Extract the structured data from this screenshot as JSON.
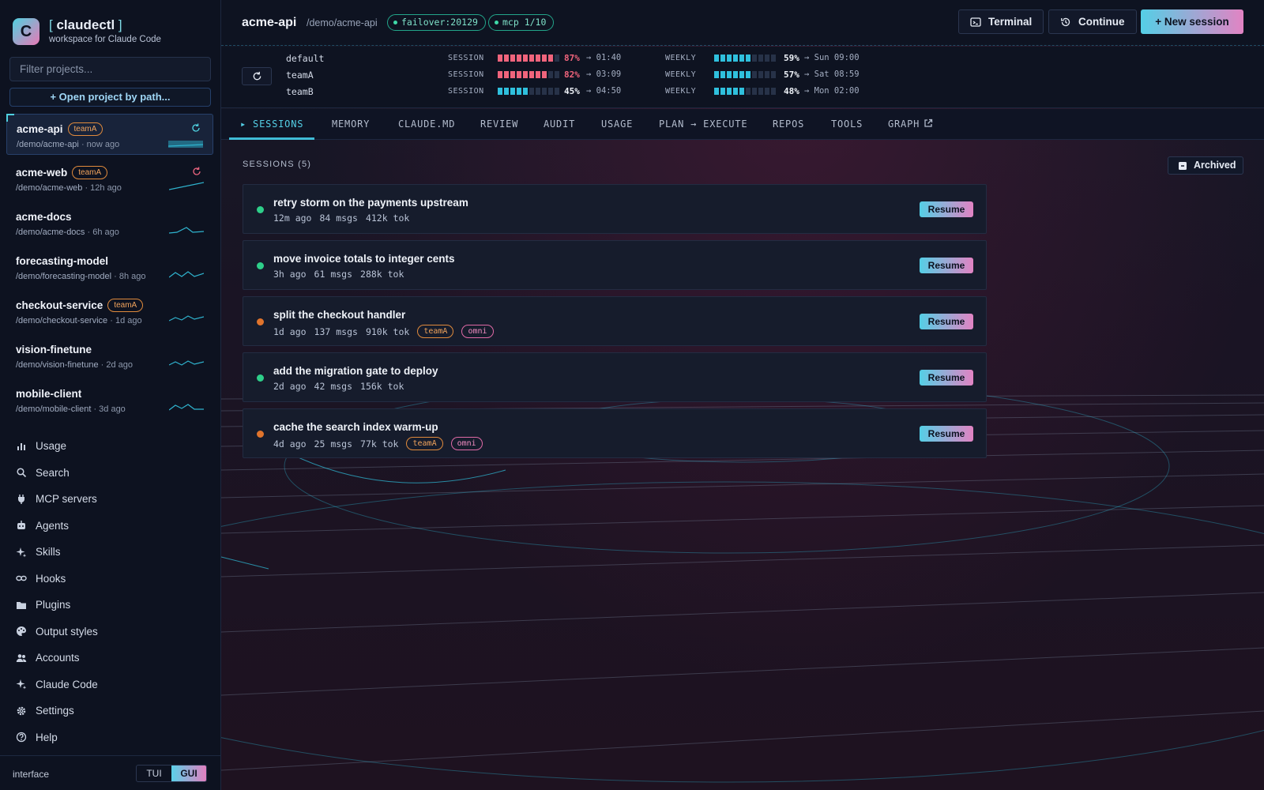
{
  "brand": {
    "logo_letter": "C",
    "bracket_open": "[",
    "name": "claudectl",
    "bracket_close": "]",
    "subtitle": "workspace for Claude Code"
  },
  "sidebar": {
    "filter_placeholder": "Filter projects...",
    "open_project_label": "+ Open project by path...",
    "projects": [
      {
        "name": "acme-api",
        "tag": "teamA",
        "path": "/demo/acme-api",
        "age": "· now ago",
        "active": true
      },
      {
        "name": "acme-web",
        "tag": "teamA",
        "path": "/demo/acme-web",
        "age": "· 12h ago"
      },
      {
        "name": "acme-docs",
        "tag": "",
        "path": "/demo/acme-docs",
        "age": "· 6h ago"
      },
      {
        "name": "forecasting-model",
        "tag": "",
        "path": "/demo/forecasting-model",
        "age": "· 8h ago"
      },
      {
        "name": "checkout-service",
        "tag": "teamA",
        "path": "/demo/checkout-service",
        "age": "· 1d ago"
      },
      {
        "name": "vision-finetune",
        "tag": "",
        "path": "/demo/vision-finetune",
        "age": "· 2d ago"
      },
      {
        "name": "mobile-client",
        "tag": "",
        "path": "/demo/mobile-client",
        "age": "· 3d ago"
      }
    ],
    "nav": [
      {
        "label": "Usage",
        "icon": "bar-chart-icon"
      },
      {
        "label": "Search",
        "icon": "search-icon"
      },
      {
        "label": "MCP servers",
        "icon": "plug-icon"
      },
      {
        "label": "Agents",
        "icon": "robot-icon"
      },
      {
        "label": "Skills",
        "icon": "sparkle-icon"
      },
      {
        "label": "Hooks",
        "icon": "link-icon"
      },
      {
        "label": "Plugins",
        "icon": "folder-icon"
      },
      {
        "label": "Output styles",
        "icon": "palette-icon"
      },
      {
        "label": "Accounts",
        "icon": "users-icon"
      },
      {
        "label": "Claude Code",
        "icon": "sparkle-icon"
      },
      {
        "label": "Settings",
        "icon": "gear-icon"
      },
      {
        "label": "Help",
        "icon": "help-icon"
      }
    ],
    "interface_label": "interface",
    "interface_options": [
      "TUI",
      "GUI"
    ],
    "interface_selected": "GUI"
  },
  "header": {
    "title": "acme-api",
    "path": "/demo/acme-api",
    "badges": [
      "failover:20129",
      "mcp 1/10"
    ],
    "terminal_label": "Terminal",
    "continue_label": "Continue",
    "new_session_label": "+  New session"
  },
  "usage": {
    "session_label": "SESSION",
    "weekly_label": "WEEKLY",
    "rows": [
      {
        "account": "default",
        "session_pct": "87%",
        "session_reset": "→ 01:40",
        "session_level": 0.87,
        "weekly_pct": "59%",
        "weekly_reset": "→ Sun 09:00",
        "weekly_level": 0.59
      },
      {
        "account": "teamA",
        "session_pct": "82%",
        "session_reset": "→ 03:09",
        "session_level": 0.82,
        "weekly_pct": "57%",
        "weekly_reset": "→ Sat 08:59",
        "weekly_level": 0.57
      },
      {
        "account": "teamB",
        "session_pct": "45%",
        "session_reset": "→ 04:50",
        "session_level": 0.45,
        "weekly_pct": "48%",
        "weekly_reset": "→ Mon 02:00",
        "weekly_level": 0.48
      }
    ],
    "colors": {
      "high": "#f0647c",
      "normal": "#2fc0dd"
    }
  },
  "tabs": [
    {
      "label": "▸ SESSIONS",
      "active": true
    },
    {
      "label": "MEMORY"
    },
    {
      "label": "CLAUDE.MD"
    },
    {
      "label": "REVIEW"
    },
    {
      "label": "AUDIT"
    },
    {
      "label": "USAGE"
    },
    {
      "label": "PLAN → EXECUTE"
    },
    {
      "label": "REPOS"
    },
    {
      "label": "TOOLS"
    },
    {
      "label": "GRAPH"
    }
  ],
  "sessions_header": "SESSIONS (5)",
  "archived_label": "Archived",
  "resume_label": "Resume",
  "sessions": [
    {
      "title": "retry storm on the payments upstream",
      "age": "12m ago",
      "msgs": "84 msgs",
      "tokens": "412k tok",
      "status_color": "#2ecf8a",
      "tags": []
    },
    {
      "title": "move invoice totals to integer cents",
      "age": "3h ago",
      "msgs": "61 msgs",
      "tokens": "288k tok",
      "status_color": "#2ecf8a",
      "tags": []
    },
    {
      "title": "split the checkout handler",
      "age": "1d ago",
      "msgs": "137 msgs",
      "tokens": "910k tok",
      "status_color": "#e0742c",
      "tags": [
        "teamA",
        "omni"
      ]
    },
    {
      "title": "add the migration gate to deploy",
      "age": "2d ago",
      "msgs": "42 msgs",
      "tokens": "156k tok",
      "status_color": "#2ecf8a",
      "tags": []
    },
    {
      "title": "cache the search index warm-up",
      "age": "4d ago",
      "msgs": "25 msgs",
      "tokens": "77k tok",
      "status_color": "#e0742c",
      "tags": [
        "teamA",
        "omni"
      ]
    }
  ]
}
